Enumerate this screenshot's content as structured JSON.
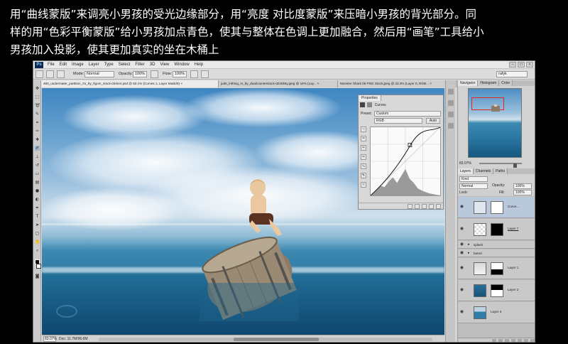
{
  "caption": {
    "line1": "用“曲线蒙版”来调亮小男孩的受光边缘部分，用“亮度 对比度蒙版”来压暗小男孩的背光部分。同",
    "line2": "样的用“色彩平衡蒙版”给小男孩加点青色，使其与整体在色调上更加融合，然后用“画笔”工具给小",
    "line3": "男孩加入投影，使其更加真实的坐在木桶上"
  },
  "app": {
    "logo": "Ps",
    "menu": [
      "File",
      "Edit",
      "Image",
      "Layer",
      "Type",
      "Select",
      "Filter",
      "3D",
      "View",
      "Window",
      "Help"
    ],
    "window_controls": [
      "–",
      "□",
      "×"
    ]
  },
  "options": {
    "mode_label": "Mode:",
    "mode_value": "Normal",
    "opacity_label": "Opacity:",
    "opacity_value": "100%",
    "flow_label": "Flow:",
    "flow_value": "100%",
    "workspace": "rafyk"
  },
  "tabs": [
    {
      "label": "480_undermater_partition_01_by_figom_stock-d4rke4.psd @ 83.1% (Curves 1, Layer Mask/8) ×",
      "active": true
    },
    {
      "label": "jude_inthing_m_by_dualcounterstock-d240k6y.jpeg @ 16% (Lay... ×",
      "active": false
    },
    {
      "label": "Monster Shark 08 PNG Stock.jpeg @ 33.3% (Layer 0, RGB... ×",
      "active": false
    }
  ],
  "properties": {
    "tab": "Properties",
    "title": "Curves",
    "preset_label": "Preset:",
    "preset_value": "Custom",
    "channel": "RGB",
    "auto": "Auto"
  },
  "navigator": {
    "tabs": [
      "Navigator",
      "Histogram",
      "Color"
    ],
    "zoom": "83.07%"
  },
  "layers_panel": {
    "tabs": [
      "Layers",
      "Channels",
      "Paths"
    ],
    "kind": "Kind",
    "blend": "Normal",
    "opacity_label": "Opacity:",
    "opacity_value": "100%",
    "lock_label": "Lock:",
    "fill_label": "Fill:",
    "fill_value": "100%",
    "layers": [
      {
        "name": "Curve...",
        "selected": true
      },
      {
        "name": "Layer 7",
        "selected": false
      },
      {
        "name": "splash",
        "group": true
      },
      {
        "name": "barrel",
        "group": true
      },
      {
        "name": "Layer 1",
        "selected": false
      },
      {
        "name": "Layer 2",
        "selected": false
      },
      {
        "name": "Layer 3",
        "selected": false
      }
    ]
  },
  "status": {
    "zoom": "83.07%",
    "doc": "Doc: 11.7M/96.6M"
  },
  "colors": {
    "ps_background": "#d6d6d6",
    "selected_layer": "#b9c8da",
    "navigator_box": "#e0281e"
  }
}
